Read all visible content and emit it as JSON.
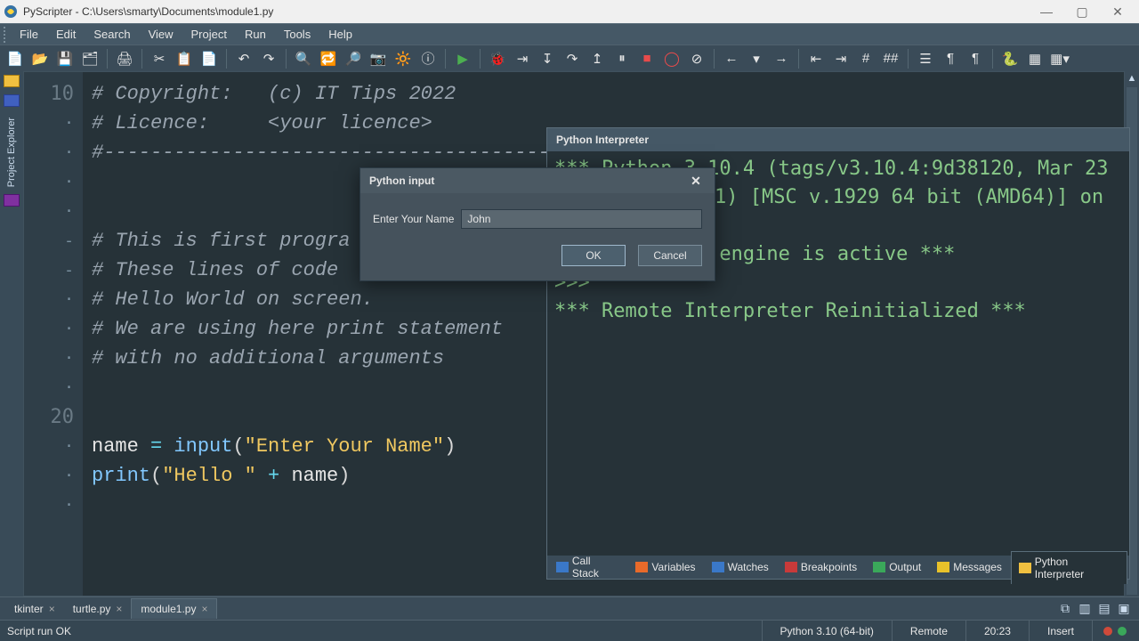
{
  "window": {
    "title": "PyScripter - C:\\Users\\smarty\\Documents\\module1.py",
    "min": "—",
    "max": "▢",
    "close": "✕"
  },
  "menu": [
    "File",
    "Edit",
    "Search",
    "View",
    "Project",
    "Run",
    "Tools",
    "Help"
  ],
  "sidebar": {
    "label": "Project Explorer"
  },
  "gutter": {
    "lines": [
      " ",
      " ",
      "10",
      "·",
      "·",
      "·",
      "·",
      "-",
      "-",
      "·",
      "·",
      "·",
      "·",
      "20",
      "·",
      "·",
      "·"
    ]
  },
  "code": {
    "l0": "# Copyright:   (c) IT Tips 2022",
    "l1": "# Licence:     <your licence>",
    "l2_prefix": "#",
    "l2_dashes": "-------------------------------------------------------------------------------",
    "l3": "# This is first progra",
    "l4": "# These lines of code",
    "l5": "# Hello World on screen.",
    "l6": "# We are using here print statement",
    "l7": "# with no additional arguments",
    "name_var": "name",
    "eq": " = ",
    "input_fn": "input",
    "input_arg": "\"Enter Your Name\"",
    "print_fn": "print",
    "print_arg1": "\"Hello \"",
    "plus": " + ",
    "print_arg2": "name",
    "rparen": ")"
  },
  "interpreter": {
    "title": "Python Interpreter",
    "line1": "*** Python 3.10.4 (tags/v3.10.4:9d38120, Mar 23",
    "line2": "1) [MSC v.1929 64 bit (AMD64)] on",
    "line3": ">>>",
    "line4": "         thon engine is active ***",
    "line5": ">>>",
    "line6": "*** Remote Interpreter Reinitialized ***"
  },
  "interp_tabs": [
    {
      "label": "Call Stack"
    },
    {
      "label": "Variables"
    },
    {
      "label": "Watches"
    },
    {
      "label": "Breakpoints"
    },
    {
      "label": "Output"
    },
    {
      "label": "Messages"
    },
    {
      "label": "Python Interpreter"
    }
  ],
  "dialog": {
    "title": "Python input",
    "label": "Enter Your Name",
    "value": "John",
    "ok": "OK",
    "cancel": "Cancel",
    "close": "✕"
  },
  "doctabs": [
    {
      "label": "tkinter",
      "close": "×"
    },
    {
      "label": "turtle.py",
      "close": "×"
    },
    {
      "label": "module1.py",
      "close": "×",
      "active": true
    }
  ],
  "status": {
    "left": "Script run OK",
    "python": "Python 3.10 (64-bit)",
    "remote": "Remote",
    "pos": "20:23",
    "insert": "Insert"
  }
}
